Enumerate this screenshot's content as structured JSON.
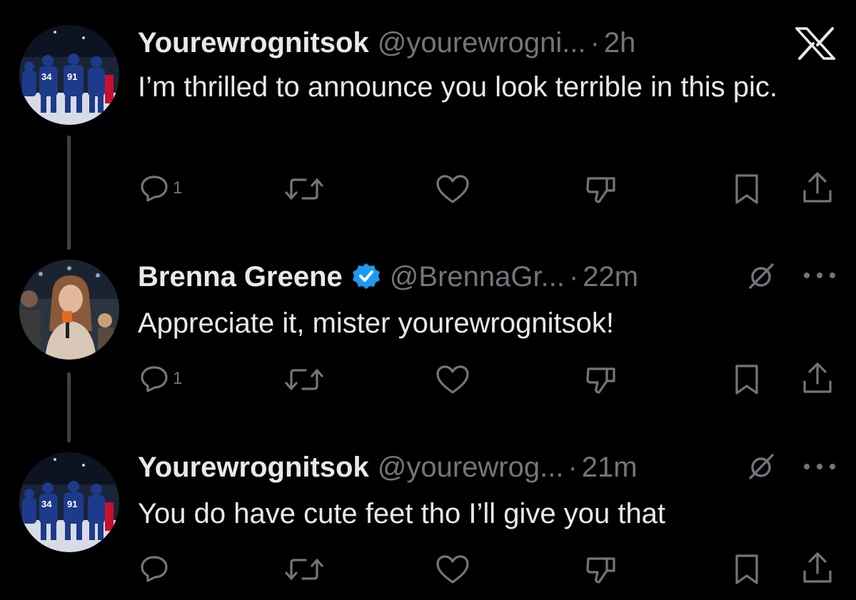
{
  "tweets": [
    {
      "name": "Yourewrognitsok",
      "handle": "@yourewrogni...",
      "sep": "·",
      "time": "2h",
      "text": "I’m thrilled to announce you look terrible in this pic.",
      "reply_count": "1",
      "avatar": "hockey-team-avatar"
    },
    {
      "name": "Brenna Greene",
      "handle": "@BrennaGr...",
      "sep": "·",
      "time": "22m",
      "text": "Appreciate it, mister yourewrognitsok!",
      "reply_count": "1",
      "verified": true,
      "avatar": "reporter-avatar"
    },
    {
      "name": "Yourewrognitsok",
      "handle": "@yourewrog...",
      "sep": "·",
      "time": "21m",
      "text": "You do have cute feet tho I’ll give you that",
      "reply_count": "",
      "avatar": "hockey-team-avatar"
    }
  ],
  "icons": [
    "reply-icon",
    "retweet-icon",
    "like-icon",
    "dislike-icon",
    "bookmark-icon",
    "share-icon",
    "x-logo-icon",
    "grok-icon",
    "more-icon",
    "verified-badge-icon"
  ],
  "colors": {
    "background": "#000000",
    "text": "#e7e9ea",
    "muted": "#71767b",
    "verified": "#1d9bf0",
    "thread_line": "#3d4145"
  }
}
